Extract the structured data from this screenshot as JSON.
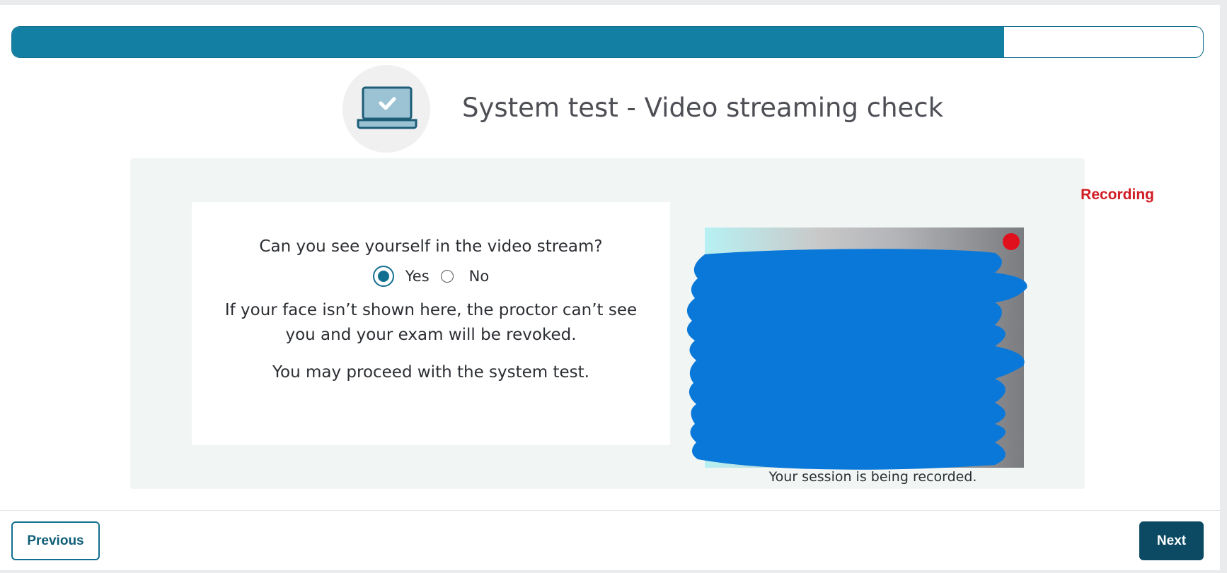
{
  "progress": {
    "percent": 83.3
  },
  "header": {
    "icon": "laptop-check-icon",
    "title": "System test - Video streaming check"
  },
  "question": {
    "prompt": "Can you see yourself in the video stream?",
    "options": [
      {
        "label": "Yes",
        "selected": true
      },
      {
        "label": "No",
        "selected": false
      }
    ],
    "warning": "If your face isn’t shown here, the proctor can’t see you and your exam will be revoked.",
    "proceed": "You may proceed with the system test."
  },
  "video": {
    "recording_label": "Recording",
    "session_text": "Your session is being recorded.",
    "recording_color": "#d11c24"
  },
  "footer": {
    "previous_label": "Previous",
    "next_label": "Next"
  },
  "colors": {
    "accent": "#136f8f",
    "progress_fill": "#1380a3",
    "next_button": "#0c4a64",
    "redaction": "#0a78d8"
  }
}
